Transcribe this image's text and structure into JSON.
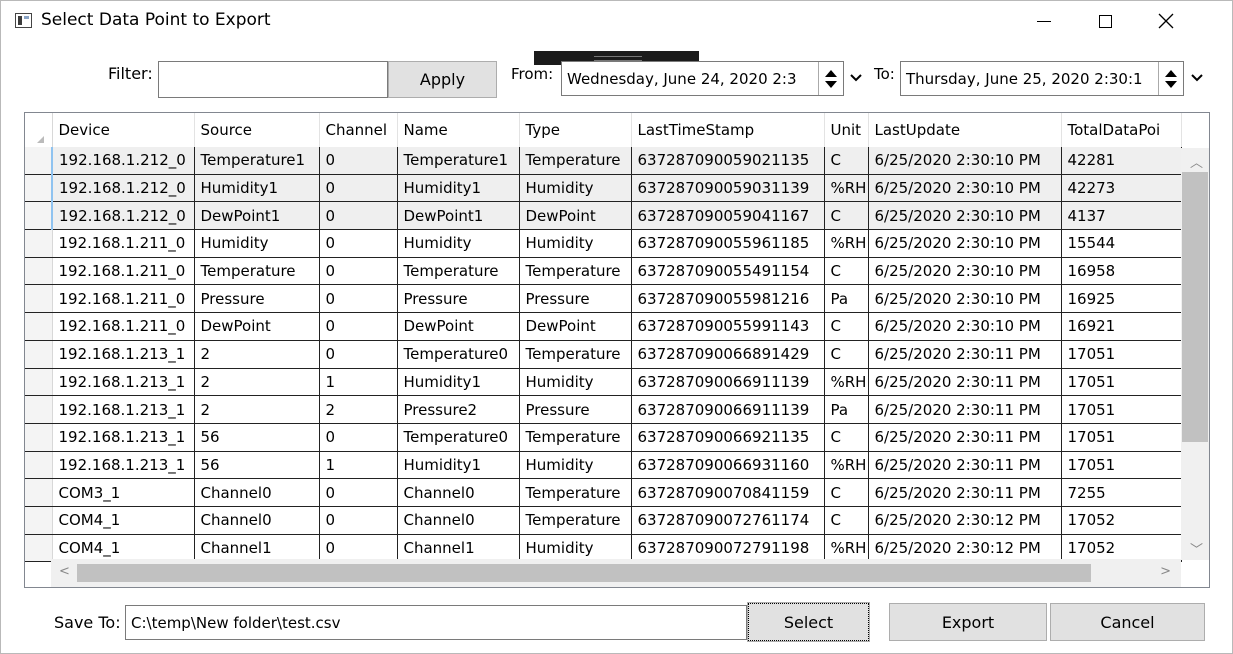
{
  "window": {
    "title": "Select Data Point to Export"
  },
  "filter": {
    "label": "Filter:",
    "value": "",
    "apply_label": "Apply"
  },
  "from": {
    "label": "From:",
    "value": "Wednesday, June 24, 2020 2:3"
  },
  "to": {
    "label": "To:",
    "value": "Thursday, June 25, 2020 2:30:1"
  },
  "table": {
    "columns": [
      "Device",
      "Source",
      "Channel",
      "Name",
      "Type",
      "LastTimeStamp",
      "Unit",
      "LastUpdate",
      "TotalDataPoi"
    ],
    "rows": [
      [
        "192.168.1.212_0",
        "Temperature1",
        "0",
        "Temperature1",
        "Temperature",
        "637287090059021135",
        "C",
        "6/25/2020 2:30:10 PM",
        "42281"
      ],
      [
        "192.168.1.212_0",
        "Humidity1",
        "0",
        "Humidity1",
        "Humidity",
        "637287090059031139",
        "%RH",
        "6/25/2020 2:30:10 PM",
        "42273"
      ],
      [
        "192.168.1.212_0",
        "DewPoint1",
        "0",
        "DewPoint1",
        "DewPoint",
        "637287090059041167",
        "C",
        "6/25/2020 2:30:10 PM",
        "4137"
      ],
      [
        "192.168.1.211_0",
        "Humidity",
        "0",
        "Humidity",
        "Humidity",
        "637287090055961185",
        "%RH",
        "6/25/2020 2:30:10 PM",
        "15544"
      ],
      [
        "192.168.1.211_0",
        "Temperature",
        "0",
        "Temperature",
        "Temperature",
        "637287090055491154",
        "C",
        "6/25/2020 2:30:10 PM",
        "16958"
      ],
      [
        "192.168.1.211_0",
        "Pressure",
        "0",
        "Pressure",
        "Pressure",
        "637287090055981216",
        "Pa",
        "6/25/2020 2:30:10 PM",
        "16925"
      ],
      [
        "192.168.1.211_0",
        "DewPoint",
        "0",
        "DewPoint",
        "DewPoint",
        "637287090055991143",
        "C",
        "6/25/2020 2:30:10 PM",
        "16921"
      ],
      [
        "192.168.1.213_1",
        "2",
        "0",
        "Temperature0",
        "Temperature",
        "637287090066891429",
        "C",
        "6/25/2020 2:30:11 PM",
        "17051"
      ],
      [
        "192.168.1.213_1",
        "2",
        "1",
        "Humidity1",
        "Humidity",
        "637287090066911139",
        "%RH",
        "6/25/2020 2:30:11 PM",
        "17051"
      ],
      [
        "192.168.1.213_1",
        "2",
        "2",
        "Pressure2",
        "Pressure",
        "637287090066911139",
        "Pa",
        "6/25/2020 2:30:11 PM",
        "17051"
      ],
      [
        "192.168.1.213_1",
        "56",
        "0",
        "Temperature0",
        "Temperature",
        "637287090066921135",
        "C",
        "6/25/2020 2:30:11 PM",
        "17051"
      ],
      [
        "192.168.1.213_1",
        "56",
        "1",
        "Humidity1",
        "Humidity",
        "637287090066931160",
        "%RH",
        "6/25/2020 2:30:11 PM",
        "17051"
      ],
      [
        "COM3_1",
        "Channel0",
        "0",
        "Channel0",
        "Temperature",
        "637287090070841159",
        "C",
        "6/25/2020 2:30:11 PM",
        "7255"
      ],
      [
        "COM4_1",
        "Channel0",
        "0",
        "Channel0",
        "Temperature",
        "637287090072761174",
        "C",
        "6/25/2020 2:30:12 PM",
        "17052"
      ],
      [
        "COM4_1",
        "Channel1",
        "0",
        "Channel1",
        "Humidity",
        "637287090072791198",
        "%RH",
        "6/25/2020 2:30:12 PM",
        "17052"
      ]
    ]
  },
  "save": {
    "label": "Save To:",
    "value": "C:\\temp\\New folder\\test.csv",
    "select_label": "Select"
  },
  "actions": {
    "export_label": "Export",
    "cancel_label": "Cancel"
  }
}
